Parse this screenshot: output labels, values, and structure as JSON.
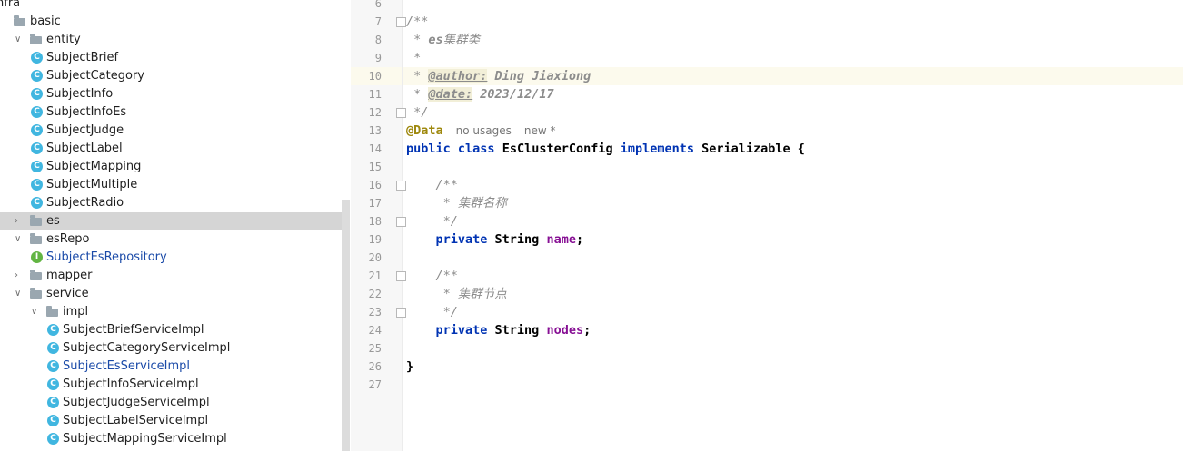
{
  "tree": {
    "rows": [
      {
        "label": "nfra",
        "type": "folder",
        "depth": 0,
        "arrow": "",
        "icon": "none"
      },
      {
        "label": "basic",
        "type": "folder",
        "depth": 0,
        "arrow": "",
        "icon": "folder"
      },
      {
        "label": "entity",
        "type": "folder",
        "depth": 1,
        "arrow": "∨",
        "icon": "folder"
      },
      {
        "label": "SubjectBrief",
        "type": "class",
        "depth": 2,
        "icon": "class"
      },
      {
        "label": "SubjectCategory",
        "type": "class",
        "depth": 2,
        "icon": "class"
      },
      {
        "label": "SubjectInfo",
        "type": "class",
        "depth": 2,
        "icon": "class"
      },
      {
        "label": "SubjectInfoEs",
        "type": "class",
        "depth": 2,
        "icon": "class"
      },
      {
        "label": "SubjectJudge",
        "type": "class",
        "depth": 2,
        "icon": "class"
      },
      {
        "label": "SubjectLabel",
        "type": "class",
        "depth": 2,
        "icon": "class"
      },
      {
        "label": "SubjectMapping",
        "type": "class",
        "depth": 2,
        "icon": "class"
      },
      {
        "label": "SubjectMultiple",
        "type": "class",
        "depth": 2,
        "icon": "class"
      },
      {
        "label": "SubjectRadio",
        "type": "class",
        "depth": 2,
        "icon": "class"
      },
      {
        "label": "es",
        "type": "folder",
        "depth": 1,
        "arrow": "›",
        "icon": "folder",
        "selected": true
      },
      {
        "label": "esRepo",
        "type": "folder",
        "depth": 1,
        "arrow": "∨",
        "icon": "folder"
      },
      {
        "label": "SubjectEsRepository",
        "type": "interface",
        "depth": 2,
        "icon": "interface",
        "blue": true
      },
      {
        "label": "mapper",
        "type": "folder",
        "depth": 1,
        "arrow": "›",
        "icon": "folder"
      },
      {
        "label": "service",
        "type": "folder",
        "depth": 1,
        "arrow": "∨",
        "icon": "folder"
      },
      {
        "label": "impl",
        "type": "folder",
        "depth": 2,
        "arrow": "∨",
        "icon": "folder"
      },
      {
        "label": "SubjectBriefServiceImpl",
        "type": "class",
        "depth": 3,
        "icon": "class"
      },
      {
        "label": "SubjectCategoryServiceImpl",
        "type": "class",
        "depth": 3,
        "icon": "class"
      },
      {
        "label": "SubjectEsServiceImpl",
        "type": "class",
        "depth": 3,
        "icon": "class",
        "blue": true
      },
      {
        "label": "SubjectInfoServiceImpl",
        "type": "class",
        "depth": 3,
        "icon": "class"
      },
      {
        "label": "SubjectJudgeServiceImpl",
        "type": "class",
        "depth": 3,
        "icon": "class"
      },
      {
        "label": "SubjectLabelServiceImpl",
        "type": "class",
        "depth": 3,
        "icon": "class"
      },
      {
        "label": "SubjectMappingServiceImpl",
        "type": "class",
        "depth": 3,
        "icon": "class"
      }
    ]
  },
  "editor": {
    "active_line": 10,
    "lines": [
      {
        "n": "6",
        "fold": false,
        "tokens": []
      },
      {
        "n": "7",
        "fold": true,
        "tokens": [
          {
            "t": "/**",
            "c": "doc"
          }
        ]
      },
      {
        "n": "8",
        "fold": false,
        "tokens": [
          {
            "t": " * ",
            "c": "doc"
          },
          {
            "t": "es",
            "c": "docval"
          },
          {
            "t": "集群类",
            "c": "doc"
          }
        ]
      },
      {
        "n": "9",
        "fold": false,
        "tokens": [
          {
            "t": " *",
            "c": "doc"
          }
        ]
      },
      {
        "n": "10",
        "fold": false,
        "tokens": [
          {
            "t": " * ",
            "c": "doc"
          },
          {
            "t": "@author:",
            "c": "doctag"
          },
          {
            "t": " Ding Jiaxiong",
            "c": "docval"
          }
        ]
      },
      {
        "n": "11",
        "fold": false,
        "tokens": [
          {
            "t": " * ",
            "c": "doc"
          },
          {
            "t": "@date:",
            "c": "doctag"
          },
          {
            "t": " 2023/12/17",
            "c": "docval"
          }
        ]
      },
      {
        "n": "12",
        "fold": true,
        "tokens": [
          {
            "t": " */",
            "c": "doc"
          }
        ]
      },
      {
        "n": "13",
        "fold": false,
        "tokens": [
          {
            "t": "@Data",
            "c": "ann"
          },
          {
            "t": "no usages",
            "c": "hint"
          },
          {
            "t": "new *",
            "c": "hint"
          }
        ]
      },
      {
        "n": "14",
        "fold": false,
        "tokens": [
          {
            "t": "public ",
            "c": "kw"
          },
          {
            "t": "class ",
            "c": "kw"
          },
          {
            "t": "EsClusterConfig ",
            "c": "ty"
          },
          {
            "t": "implements ",
            "c": "kw"
          },
          {
            "t": "Serializable {",
            "c": "ty"
          }
        ]
      },
      {
        "n": "15",
        "fold": false,
        "tokens": []
      },
      {
        "n": "16",
        "fold": true,
        "tokens": [
          {
            "t": "    /**",
            "c": "doc"
          }
        ]
      },
      {
        "n": "17",
        "fold": false,
        "tokens": [
          {
            "t": "     * 集群名称",
            "c": "doc"
          }
        ]
      },
      {
        "n": "18",
        "fold": true,
        "tokens": [
          {
            "t": "     */",
            "c": "doc"
          }
        ]
      },
      {
        "n": "19",
        "fold": false,
        "tokens": [
          {
            "t": "    private ",
            "c": "kw"
          },
          {
            "t": "String ",
            "c": "ty"
          },
          {
            "t": "name",
            "c": "fld"
          },
          {
            "t": ";",
            "c": "ty"
          }
        ]
      },
      {
        "n": "20",
        "fold": false,
        "tokens": []
      },
      {
        "n": "21",
        "fold": true,
        "tokens": [
          {
            "t": "    /**",
            "c": "doc"
          }
        ]
      },
      {
        "n": "22",
        "fold": false,
        "tokens": [
          {
            "t": "     * 集群节点",
            "c": "doc"
          }
        ]
      },
      {
        "n": "23",
        "fold": true,
        "tokens": [
          {
            "t": "     */",
            "c": "doc"
          }
        ]
      },
      {
        "n": "24",
        "fold": false,
        "tokens": [
          {
            "t": "    private ",
            "c": "kw"
          },
          {
            "t": "String ",
            "c": "ty"
          },
          {
            "t": "nodes",
            "c": "fld"
          },
          {
            "t": ";",
            "c": "ty"
          }
        ]
      },
      {
        "n": "25",
        "fold": false,
        "tokens": []
      },
      {
        "n": "26",
        "fold": false,
        "tokens": [
          {
            "t": "}",
            "c": "ty"
          }
        ]
      },
      {
        "n": "27",
        "fold": false,
        "tokens": []
      }
    ]
  },
  "colors": {
    "keyword": "#0033b3",
    "field": "#871094",
    "annotation": "#9e880d",
    "comment": "#8c8c8c",
    "class_icon": "#40b6e0",
    "interface_icon": "#62b543",
    "selection": "#d5d5d5",
    "active_line": "#fcfaed"
  }
}
